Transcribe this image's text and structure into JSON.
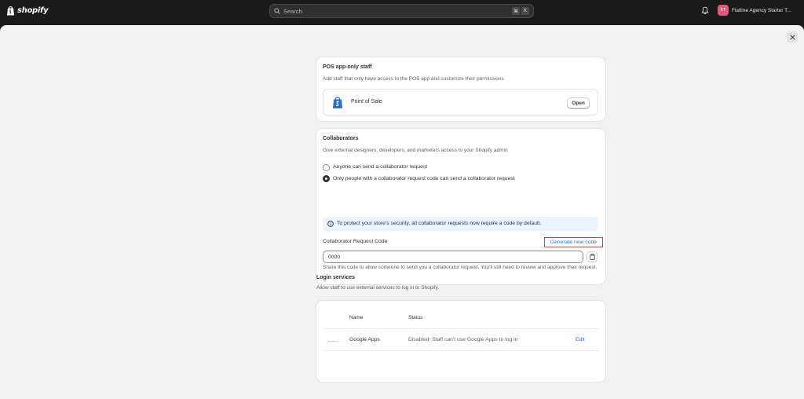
{
  "topbar": {
    "logo_text": "shopify",
    "search_placeholder": "Search",
    "shortcut_keys": [
      "⌘",
      "K"
    ],
    "avatar_initials": "FT",
    "store_name": "Flatline Agency Starter T..."
  },
  "pos": {
    "title": "POS app-only staff",
    "description": "Add staff that only have access to the POS app and customize their permissions",
    "app_name": "Point of Sale",
    "open_label": "Open"
  },
  "collaborators": {
    "title": "Collaborators",
    "description": "Give external designers, developers, and marketers access to your Shopify admin",
    "options": [
      {
        "label": "Anyone can send a collaborator request",
        "selected": false
      },
      {
        "label": "Only people with a collaborator request code can send a collaborator request",
        "selected": true
      }
    ],
    "banner_text": "To protect your store's security, all collaborator requests now require a code by default.",
    "code_label": "Collaborator Request Code",
    "generate_label": "Generate new code",
    "code_value": "0000",
    "helper_text": "Share this code to allow someone to send you a collaborator request. You'll still need to review and approve their request."
  },
  "login": {
    "title": "Login services",
    "description": "Allow staff to use external services to log in to Shopify.",
    "columns": [
      "Name",
      "Status"
    ],
    "rows": [
      {
        "name": "Google Apps",
        "status": "Disabled: Staff can't use Google Apps to log in",
        "action": "Edit"
      }
    ]
  },
  "colors": {
    "topbar": "#1a1a1a",
    "background": "#f1f1f1",
    "link": "#2c6ecb",
    "highlight_border": "#d23b3b",
    "avatar": "#e4577a"
  }
}
